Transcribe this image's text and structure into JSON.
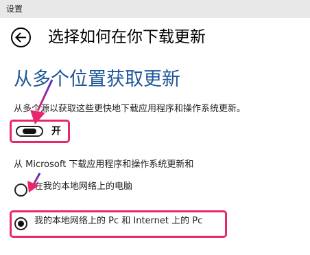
{
  "window": {
    "title": "设置"
  },
  "header": {
    "back_icon": "back-arrow-icon",
    "title": "选择如何在你下载更新"
  },
  "section": {
    "title": "从多个位置获取更新",
    "description": "从多个源以获取这些更快地下载应用程序和操作系统更新。"
  },
  "toggle": {
    "state_label": "开",
    "on": true
  },
  "source": {
    "label": "从 Microsoft 下载应用程序和操作系统更新和",
    "options": [
      {
        "label": "在我的本地网络上的电脑",
        "selected": false
      },
      {
        "label": "我的本地网络上的 Pc 和 Internet 上的 Pc",
        "selected": true
      }
    ]
  },
  "colors": {
    "accent": "#1e5799",
    "highlight": "#e8266d",
    "arrow": "#7a2fd4"
  }
}
